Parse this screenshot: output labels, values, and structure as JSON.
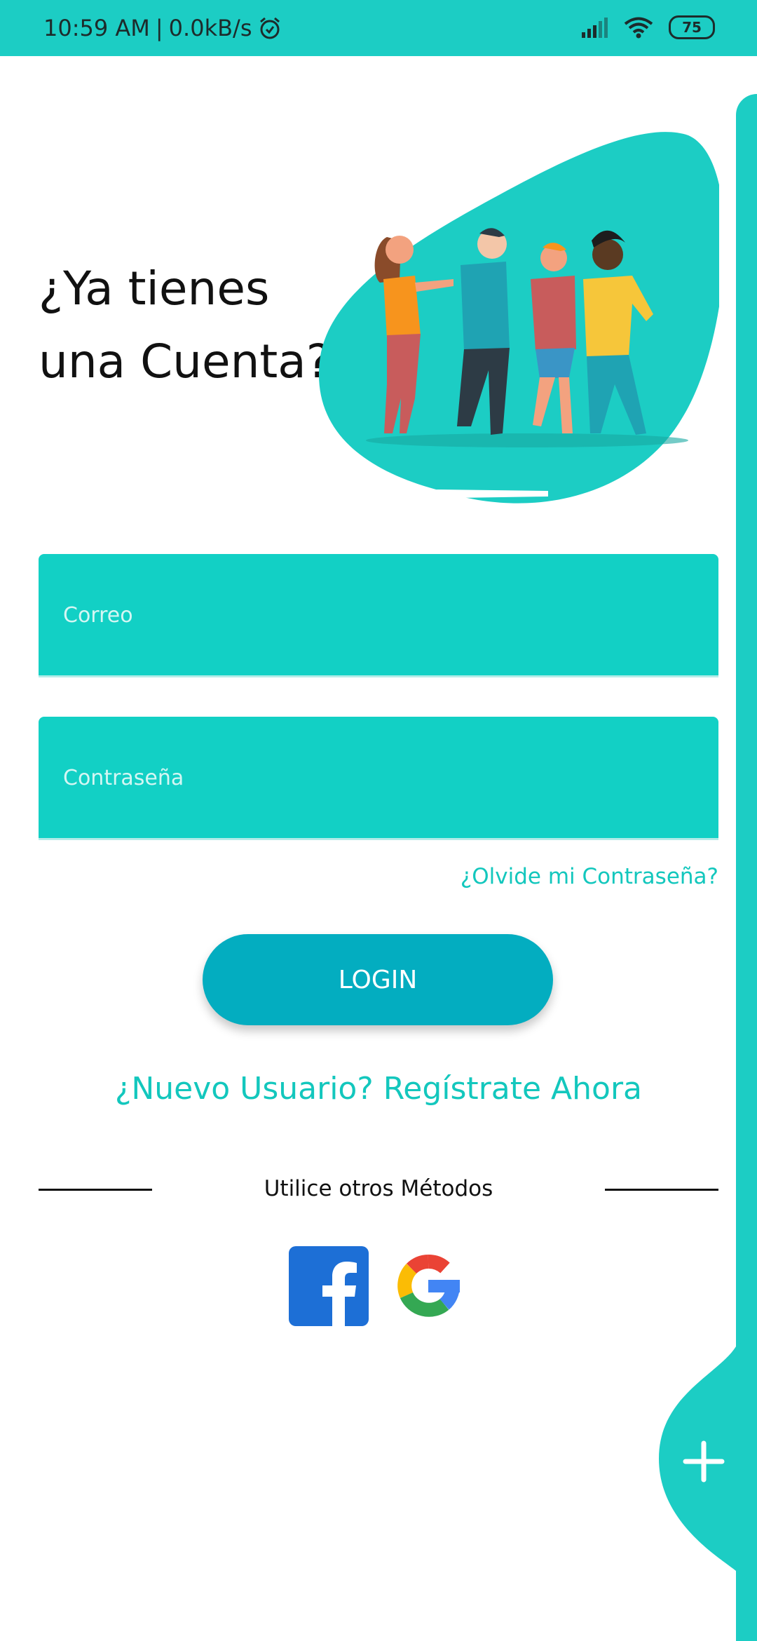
{
  "status_bar": {
    "time": "10:59 AM",
    "network_speed": "0.0kB/s",
    "battery": "75",
    "icons": [
      "alarm-icon",
      "signal-icon",
      "wifi-icon",
      "battery-icon"
    ]
  },
  "hero": {
    "heading_line1": "¿Ya tienes",
    "heading_line2": "una Cuenta?",
    "illustration": "group-of-friends-illustration"
  },
  "form": {
    "email_placeholder": "Correo",
    "password_placeholder": "Contraseña",
    "forgot_password": "¿Olvide mi Contraseña?",
    "login_label": "LOGIN",
    "register_link": "¿Nuevo Usuario? Regístrate Ahora"
  },
  "social": {
    "label": "Utilice otros Métodos",
    "providers": [
      "facebook-icon",
      "google-icon"
    ]
  },
  "side": {
    "fab_icon": "plus-icon"
  },
  "colors": {
    "accent": "#1ccdc4",
    "field": "#12d0c5",
    "button": "#03adc0",
    "link": "#13c7bd"
  }
}
